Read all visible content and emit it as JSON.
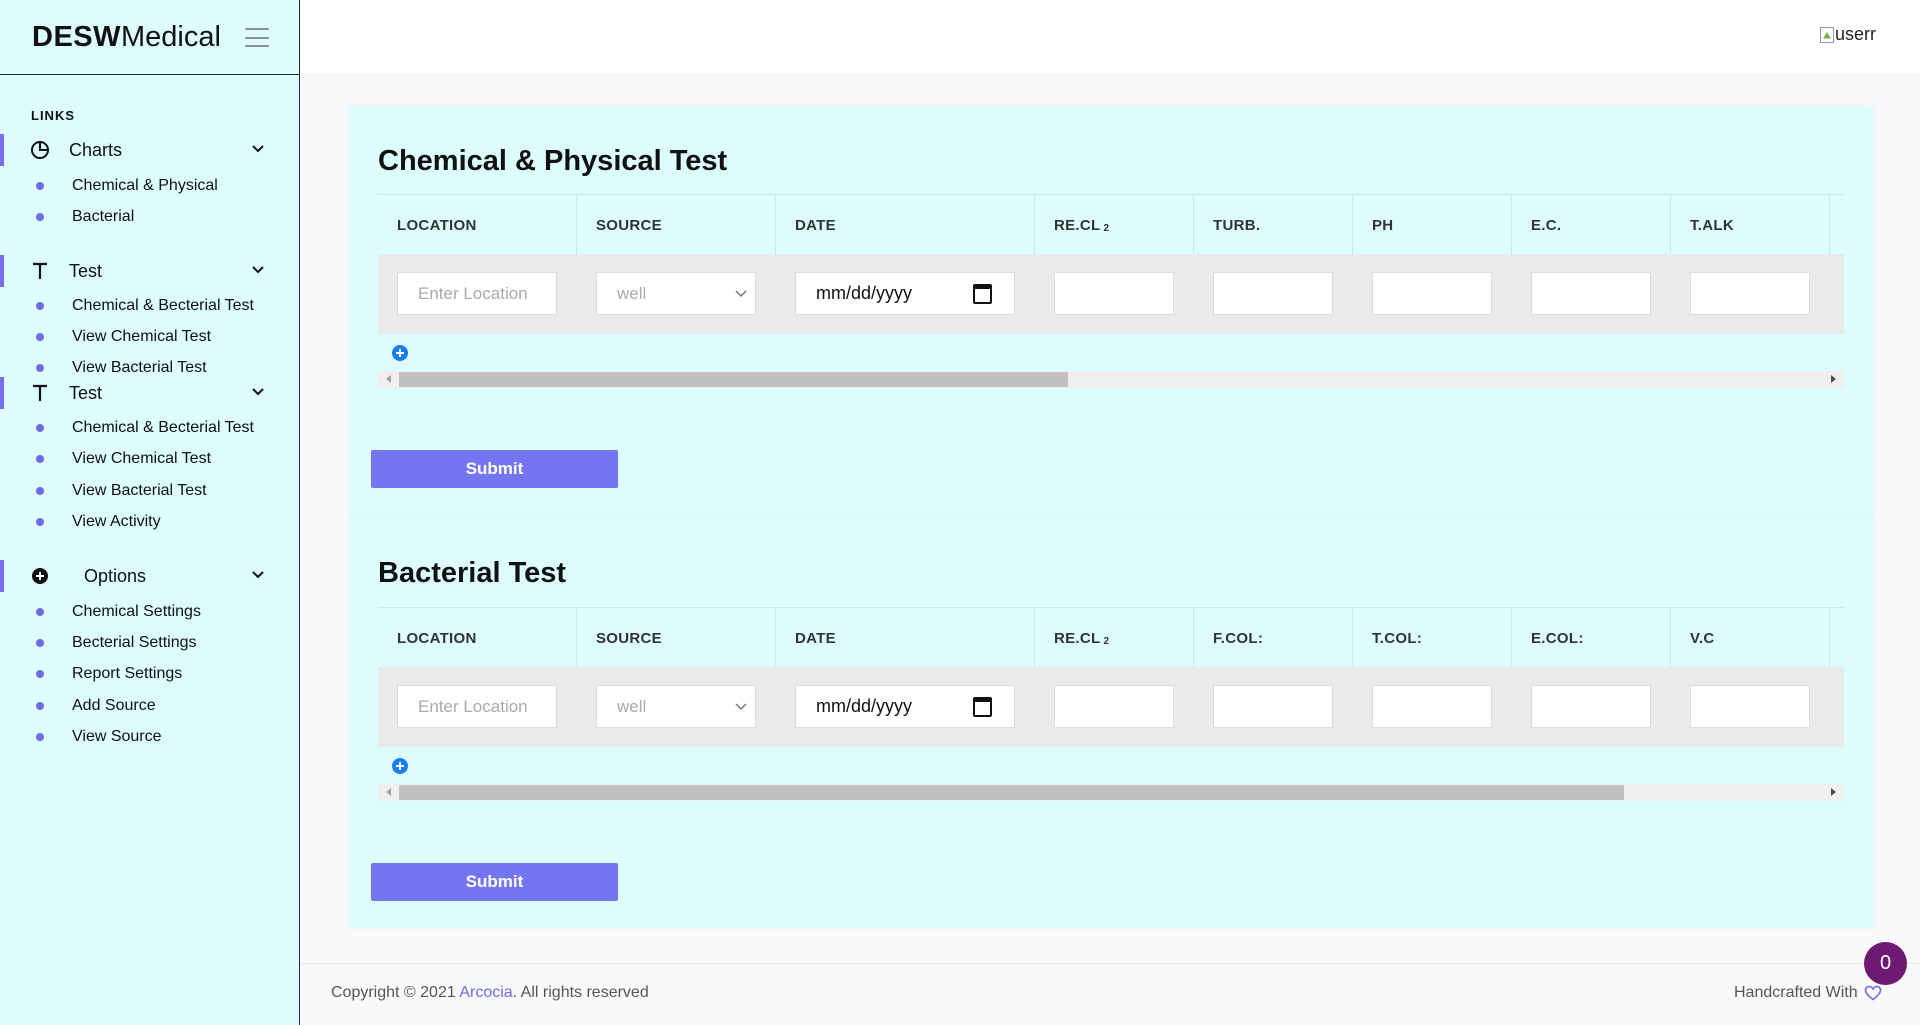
{
  "brand": {
    "bold": "DESW",
    "light": "Medical"
  },
  "sidebar": {
    "links_label": "LINKS",
    "groups": [
      {
        "label": "Charts",
        "icon": "pie-chart-icon",
        "items": [
          {
            "label": "Chemical & Physical"
          },
          {
            "label": "Bacterial"
          }
        ]
      },
      {
        "label": "Test",
        "icon": "text-t-icon",
        "items": [
          {
            "label": "Chemical & Becterial Test"
          },
          {
            "label": "View Chemical Test"
          },
          {
            "label": "View Bacterial Test"
          }
        ]
      },
      {
        "label": "Test",
        "icon": "text-t-icon",
        "items": [
          {
            "label": "Chemical & Becterial Test"
          },
          {
            "label": "View Chemical Test"
          },
          {
            "label": "View Bacterial Test"
          },
          {
            "label": "View Activity"
          }
        ]
      },
      {
        "label": "Options",
        "icon": "plus-circle-icon",
        "items": [
          {
            "label": "Chemical Settings"
          },
          {
            "label": "Becterial Settings"
          },
          {
            "label": "Report Settings"
          },
          {
            "label": "Add Source"
          },
          {
            "label": "View Source"
          }
        ]
      }
    ]
  },
  "topbar": {
    "user_alt": "userr"
  },
  "chemical": {
    "title": "Chemical & Physical Test",
    "columns": [
      "LOCATION",
      "SOURCE",
      "DATE",
      "RE.CL",
      "TURB.",
      "PH",
      "E.C.",
      "T.ALK"
    ],
    "recl_sub": "2",
    "location_placeholder": "Enter Location",
    "source_value": "well",
    "date_placeholder": "mm/dd/yyyy",
    "scroll_fraction": 0.47,
    "submit": "Submit"
  },
  "bacterial": {
    "title": "Bacterial Test",
    "columns": [
      "LOCATION",
      "SOURCE",
      "DATE",
      "RE.CL",
      "F.COL:",
      "T.COL:",
      "E.COL:",
      "V.C"
    ],
    "recl_sub": "2",
    "location_placeholder": "Enter Location",
    "source_value": "well",
    "date_placeholder": "mm/dd/yyyy",
    "scroll_fraction": 0.86,
    "submit": "Submit"
  },
  "footer": {
    "copyright_prefix": "Copyright © 2021 ",
    "copyright_link": "Arcocia",
    "copyright_suffix": ". All rights reserved",
    "handcrafted": "Handcrafted With",
    "heart_icon": "heart-icon"
  },
  "badge": {
    "count": "0"
  },
  "colors": {
    "sidebar_bg": "#dcfcfd",
    "accent": "#7476f1",
    "badge": "#6e1a72",
    "link": "#6f6ce0"
  }
}
